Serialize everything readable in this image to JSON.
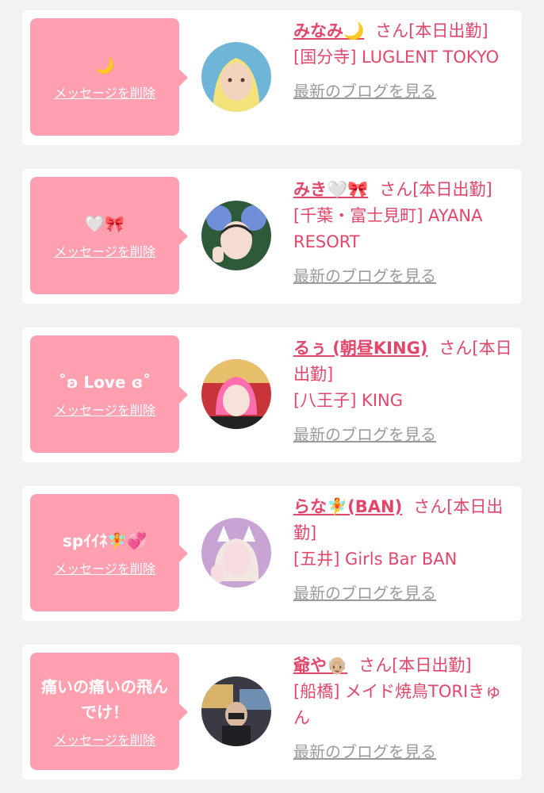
{
  "delete_label": "メッセージを削除",
  "blog_label": "最新のブログを見る",
  "suffix_label": "さん[本日出勤]",
  "colors": {
    "accent": "#e2466b",
    "bubble": "#ff9fb0",
    "link_gray": "#9a9a9a",
    "background": "#f2f2f2"
  },
  "cards": [
    {
      "message": "🌙",
      "name": "みなみ🌙",
      "shop": "[国分寺] LUGLENT TOKYO"
    },
    {
      "message": "🤍🎀",
      "name": "みき🤍🎀",
      "shop": "[千葉・富士見町] AYANA RESORT"
    },
    {
      "message": "˚ʚ Love ɞ˚",
      "name": "るぅ (朝昼KING)",
      "shop": "[八王子] KING"
    },
    {
      "message": "spｲｲﾈ🧚💞",
      "name": "らな🧚(BAN)",
      "shop": "[五井] Girls Bar BAN"
    },
    {
      "message": "痛いの痛いの飛んでけ！",
      "name": "爺や👴🏼",
      "shop": "[船橋] メイド焼鳥TORIきゅん"
    }
  ]
}
